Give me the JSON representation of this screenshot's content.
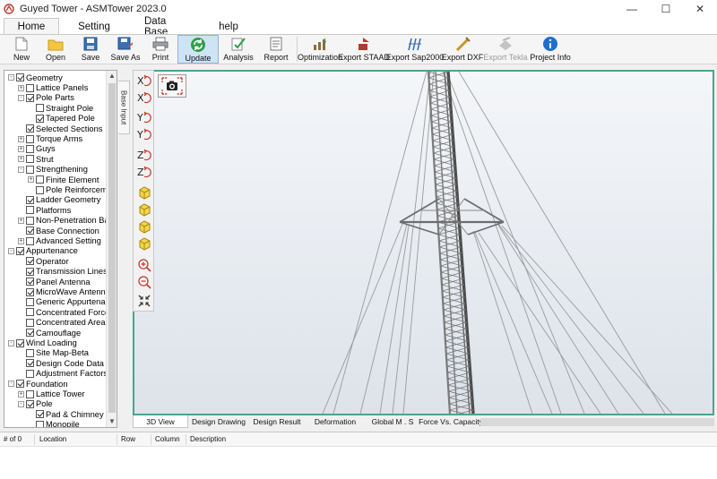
{
  "window": {
    "title": "Guyed Tower - ASMTower 2023.0",
    "controls": [
      "—",
      "☐",
      "✕"
    ]
  },
  "ribbon": {
    "tabs": [
      {
        "label": "Home",
        "active": true
      },
      {
        "label": "Setting",
        "active": false
      },
      {
        "label": "Data Base",
        "active": false
      },
      {
        "label": "help",
        "active": false
      }
    ]
  },
  "toolbar": {
    "buttons": [
      {
        "label": "New",
        "icon": "new-file-icon"
      },
      {
        "label": "Open",
        "icon": "folder-icon"
      },
      {
        "label": "Save",
        "icon": "floppy-icon"
      },
      {
        "label": "Save As",
        "icon": "save-as-icon"
      },
      {
        "label": "Print",
        "icon": "printer-icon"
      },
      {
        "label": "Update",
        "icon": "refresh-icon",
        "active": true
      },
      {
        "label": "Analysis",
        "icon": "analysis-check-icon"
      },
      {
        "label": "Report",
        "icon": "report-icon"
      },
      {
        "label": "Optimization",
        "icon": "optimization-chart-icon"
      },
      {
        "label": "Export STAAD",
        "icon": "export-staad-icon"
      },
      {
        "label": "Export Sap2000",
        "icon": "export-sap-icon"
      },
      {
        "label": "Export DXF",
        "icon": "export-dxf-icon"
      },
      {
        "label": "Export Tekla",
        "icon": "export-tekla-icon",
        "disabled": true
      },
      {
        "label": "Project Info",
        "icon": "info-icon"
      }
    ]
  },
  "tree": {
    "items": [
      {
        "label": "Geometry",
        "level": 0,
        "expander": "-",
        "checked": true
      },
      {
        "label": "Lattice Panels",
        "level": 1,
        "expander": "+",
        "checked": false
      },
      {
        "label": "Pole Parts",
        "level": 1,
        "expander": "-",
        "checked": true
      },
      {
        "label": "Straight Pole",
        "level": 2,
        "expander": "",
        "checked": false
      },
      {
        "label": "Tapered Pole",
        "level": 2,
        "expander": "",
        "checked": true
      },
      {
        "label": "Selected Sections",
        "level": 1,
        "expander": "",
        "checked": true
      },
      {
        "label": "Torque Arms",
        "level": 1,
        "expander": "+",
        "checked": false
      },
      {
        "label": "Guys",
        "level": 1,
        "expander": "+",
        "checked": false
      },
      {
        "label": "Strut",
        "level": 1,
        "expander": "+",
        "checked": false
      },
      {
        "label": "Strengthening",
        "level": 1,
        "expander": "-",
        "checked": false
      },
      {
        "label": "Finite Element",
        "level": 2,
        "expander": "+",
        "checked": false
      },
      {
        "label": "Pole Reinforcement",
        "level": 2,
        "expander": "",
        "checked": false
      },
      {
        "label": "Ladder Geometry",
        "level": 1,
        "expander": "",
        "checked": true
      },
      {
        "label": "Platforms",
        "level": 1,
        "expander": "",
        "checked": false
      },
      {
        "label": "Non-Penetration Base",
        "level": 1,
        "expander": "+",
        "checked": false
      },
      {
        "label": "Base Connection",
        "level": 1,
        "expander": "",
        "checked": true
      },
      {
        "label": "Advanced Setting",
        "level": 1,
        "expander": "+",
        "checked": false
      },
      {
        "label": "Appurtenance",
        "level": 0,
        "expander": "-",
        "checked": true
      },
      {
        "label": "Operator",
        "level": 1,
        "expander": "",
        "checked": true
      },
      {
        "label": "Transmission Lines",
        "level": 1,
        "expander": "",
        "checked": true
      },
      {
        "label": "Panel Antenna",
        "level": 1,
        "expander": "",
        "checked": true
      },
      {
        "label": "MicroWave Antenna",
        "level": 1,
        "expander": "",
        "checked": true
      },
      {
        "label": "Generic Appurtenance",
        "level": 1,
        "expander": "",
        "checked": false
      },
      {
        "label": "Concentrated Force",
        "level": 1,
        "expander": "",
        "checked": false
      },
      {
        "label": "Concentrated Area",
        "level": 1,
        "expander": "",
        "checked": false
      },
      {
        "label": "Camouflage",
        "level": 1,
        "expander": "",
        "checked": true
      },
      {
        "label": "Wind Loading",
        "level": 0,
        "expander": "-",
        "checked": true
      },
      {
        "label": "Site Map-Beta",
        "level": 1,
        "expander": "",
        "checked": false
      },
      {
        "label": "Design Code Data",
        "level": 1,
        "expander": "",
        "checked": true
      },
      {
        "label": "Adjustment Factors",
        "level": 1,
        "expander": "",
        "checked": false
      },
      {
        "label": "Foundation",
        "level": 0,
        "expander": "-",
        "checked": true
      },
      {
        "label": "Lattice Tower",
        "level": 1,
        "expander": "+",
        "checked": false
      },
      {
        "label": "Pole",
        "level": 1,
        "expander": "-",
        "checked": true
      },
      {
        "label": "Pad & Chimney",
        "level": 2,
        "expander": "",
        "checked": true
      },
      {
        "label": "Monopile",
        "level": 2,
        "expander": "",
        "checked": false
      }
    ]
  },
  "side_tab": {
    "label": "Base Input"
  },
  "vertical_tools": [
    {
      "icon": "rotate-x-pos-icon",
      "label": "X"
    },
    {
      "icon": "rotate-x-neg-icon",
      "label": "X"
    },
    {
      "icon": "rotate-y-pos-icon",
      "label": "Y"
    },
    {
      "icon": "rotate-y-neg-icon",
      "label": "Y"
    },
    {
      "icon": "rotate-z-pos-icon",
      "label": "Z"
    },
    {
      "icon": "rotate-z-neg-icon",
      "label": "Z"
    },
    {
      "icon": "view-cube-front-icon",
      "label": ""
    },
    {
      "icon": "view-cube-side-icon",
      "label": ""
    },
    {
      "icon": "view-cube-top-icon",
      "label": ""
    },
    {
      "icon": "view-cube-iso-icon",
      "label": ""
    },
    {
      "icon": "zoom-in-icon",
      "label": ""
    },
    {
      "icon": "zoom-out-icon",
      "label": ""
    },
    {
      "icon": "fit-extents-icon",
      "label": ""
    }
  ],
  "viewport": {
    "border_color": "#4aa58e",
    "tower_color": "#7a7a7a",
    "guy_color": "#9a9a9a"
  },
  "view_tabs": [
    {
      "label": "3D View",
      "active": true
    },
    {
      "label": "Design Drawing",
      "active": false
    },
    {
      "label": "Design Result",
      "active": false
    },
    {
      "label": "Deformation",
      "active": false
    },
    {
      "label": "Global M . S",
      "active": false
    },
    {
      "label": "Force Vs. Capacity",
      "active": false
    }
  ],
  "messages": {
    "columns": [
      "# of 0",
      "Location",
      "Row",
      "Column",
      "Description"
    ]
  }
}
